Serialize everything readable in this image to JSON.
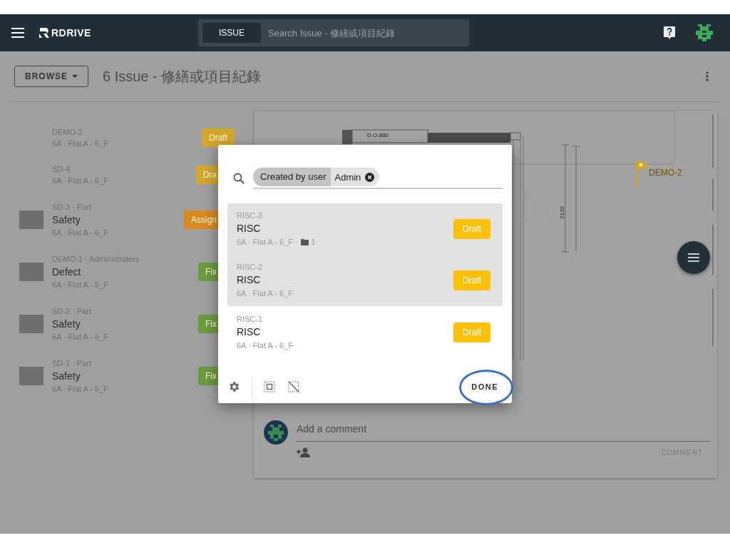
{
  "header": {
    "logo": "RDRIVE",
    "search": {
      "scope": "ISSUE",
      "placeholder": "Search Issue - 修繕或項目紀錄"
    }
  },
  "toolbar": {
    "browse": "BROWSE",
    "title": "6 Issue - 修繕或項目紀錄"
  },
  "issues": [
    {
      "id": "DEMO-2",
      "location": "6A · Flat A - 6_F",
      "photo": false,
      "badge": {
        "text": "Draft",
        "color": "#d4a62a",
        "cut": false
      }
    },
    {
      "id": "SD-4",
      "location": "6A · Flat A - 6_F",
      "photo": false,
      "badge": {
        "text": "Dra",
        "color": "#d4a62a",
        "cut": true
      }
    },
    {
      "id": "SD-3 · Part",
      "title": "Safety",
      "location": "6A · Flat A - 6_F",
      "photo": true,
      "badge": {
        "text": "Assign",
        "color": "#d88a1f",
        "cut": true
      }
    },
    {
      "id": "DEMO-1 · Administrators",
      "title": "Defect",
      "location": "6A · Flat A - 6_F",
      "photo": true,
      "badge": {
        "text": "Fix",
        "color": "#6b9b3e",
        "cut": true
      }
    },
    {
      "id": "SD-2 · Part",
      "title": "Safety",
      "location": "6A · Flat A - 6_F",
      "photo": true,
      "badge": {
        "text": "Fix",
        "color": "#6b9b3e",
        "cut": true
      }
    },
    {
      "id": "SD-1 · Part",
      "title": "Safety",
      "location": "6A · Flat A - 6_F",
      "photo": true,
      "badge": {
        "text": "Fix",
        "color": "#6b9b3e",
        "cut": true
      }
    }
  ],
  "plan": {
    "labels": [
      "D.O.880",
      "2120"
    ],
    "marker": "DEMO-2"
  },
  "dialog": {
    "filter": {
      "field": "Created by user",
      "value": "Admin"
    },
    "results": [
      {
        "id": "RISC-3",
        "title": "RISC",
        "location": "6A · Flat A - 6_F ·",
        "attachments": "1",
        "status": "Draft",
        "selected": true
      },
      {
        "id": "RISC-2",
        "title": "RISC",
        "location": "6A · Flat A - 6_F",
        "status": "Draft",
        "selected": true
      },
      {
        "id": "RISC-1",
        "title": "RISC",
        "location": "6A · Flat A - 6_F",
        "status": "Draft",
        "selected": false
      }
    ],
    "done": "DONE"
  },
  "comment": {
    "placeholder": "Add a comment",
    "button": "COMMENT"
  }
}
